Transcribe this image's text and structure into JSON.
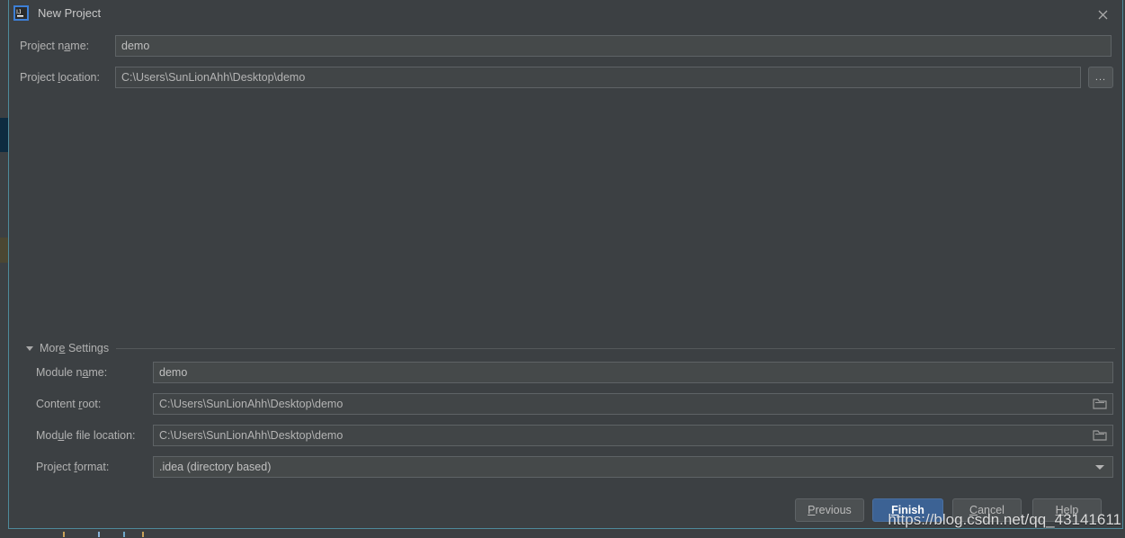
{
  "window": {
    "title": "New Project",
    "app_icon": "intellij-idea-icon",
    "close_icon": "close-icon",
    "border_color": "#4e8a9b",
    "background_color": "#3c4043"
  },
  "form": {
    "project_name": {
      "label_pre": "Project n",
      "label_mnemonic": "a",
      "label_post": "me:",
      "value": "demo",
      "placeholder": ""
    },
    "project_location": {
      "label_pre": "Project ",
      "label_mnemonic": "l",
      "label_post": "ocation:",
      "value": "C:\\Users\\SunLionAhh\\Desktop\\demo",
      "placeholder": "",
      "browse_label": "..."
    }
  },
  "more_settings": {
    "label_pre": "Mor",
    "label_mnemonic": "e",
    "label_post": " Settings",
    "expanded": true,
    "triangle_icon": "chevron-down-icon",
    "rows": {
      "module_name": {
        "label_pre": "Module n",
        "label_mnemonic": "a",
        "label_post": "me:",
        "value": "demo"
      },
      "content_root": {
        "label_pre": "Content ",
        "label_mnemonic": "r",
        "label_post": "oot:",
        "value": "C:\\Users\\SunLionAhh\\Desktop\\demo",
        "icon": "folder-icon"
      },
      "module_file_location": {
        "label_pre": "Mod",
        "label_mnemonic": "u",
        "label_post": "le file location:",
        "value": "C:\\Users\\SunLionAhh\\Desktop\\demo",
        "icon": "folder-icon"
      },
      "project_format": {
        "label_pre": "Project ",
        "label_mnemonic": "f",
        "label_post": "ormat:",
        "value": ".idea (directory based)",
        "icon": "chevron-down-icon",
        "options": [
          ".idea (directory based)"
        ]
      }
    }
  },
  "buttons": {
    "previous": {
      "pre": "",
      "mnemonic": "P",
      "post": "revious"
    },
    "finish": {
      "pre": "",
      "mnemonic": "F",
      "post": "inish",
      "primary": true,
      "accent_color": "#3c6294"
    },
    "cancel": {
      "pre": "",
      "mnemonic": "C",
      "post": "ancel"
    },
    "help": {
      "pre": "",
      "mnemonic": "H",
      "post": "elp"
    }
  },
  "watermark": {
    "text": "https://blog.csdn.net/qq_43141611"
  }
}
